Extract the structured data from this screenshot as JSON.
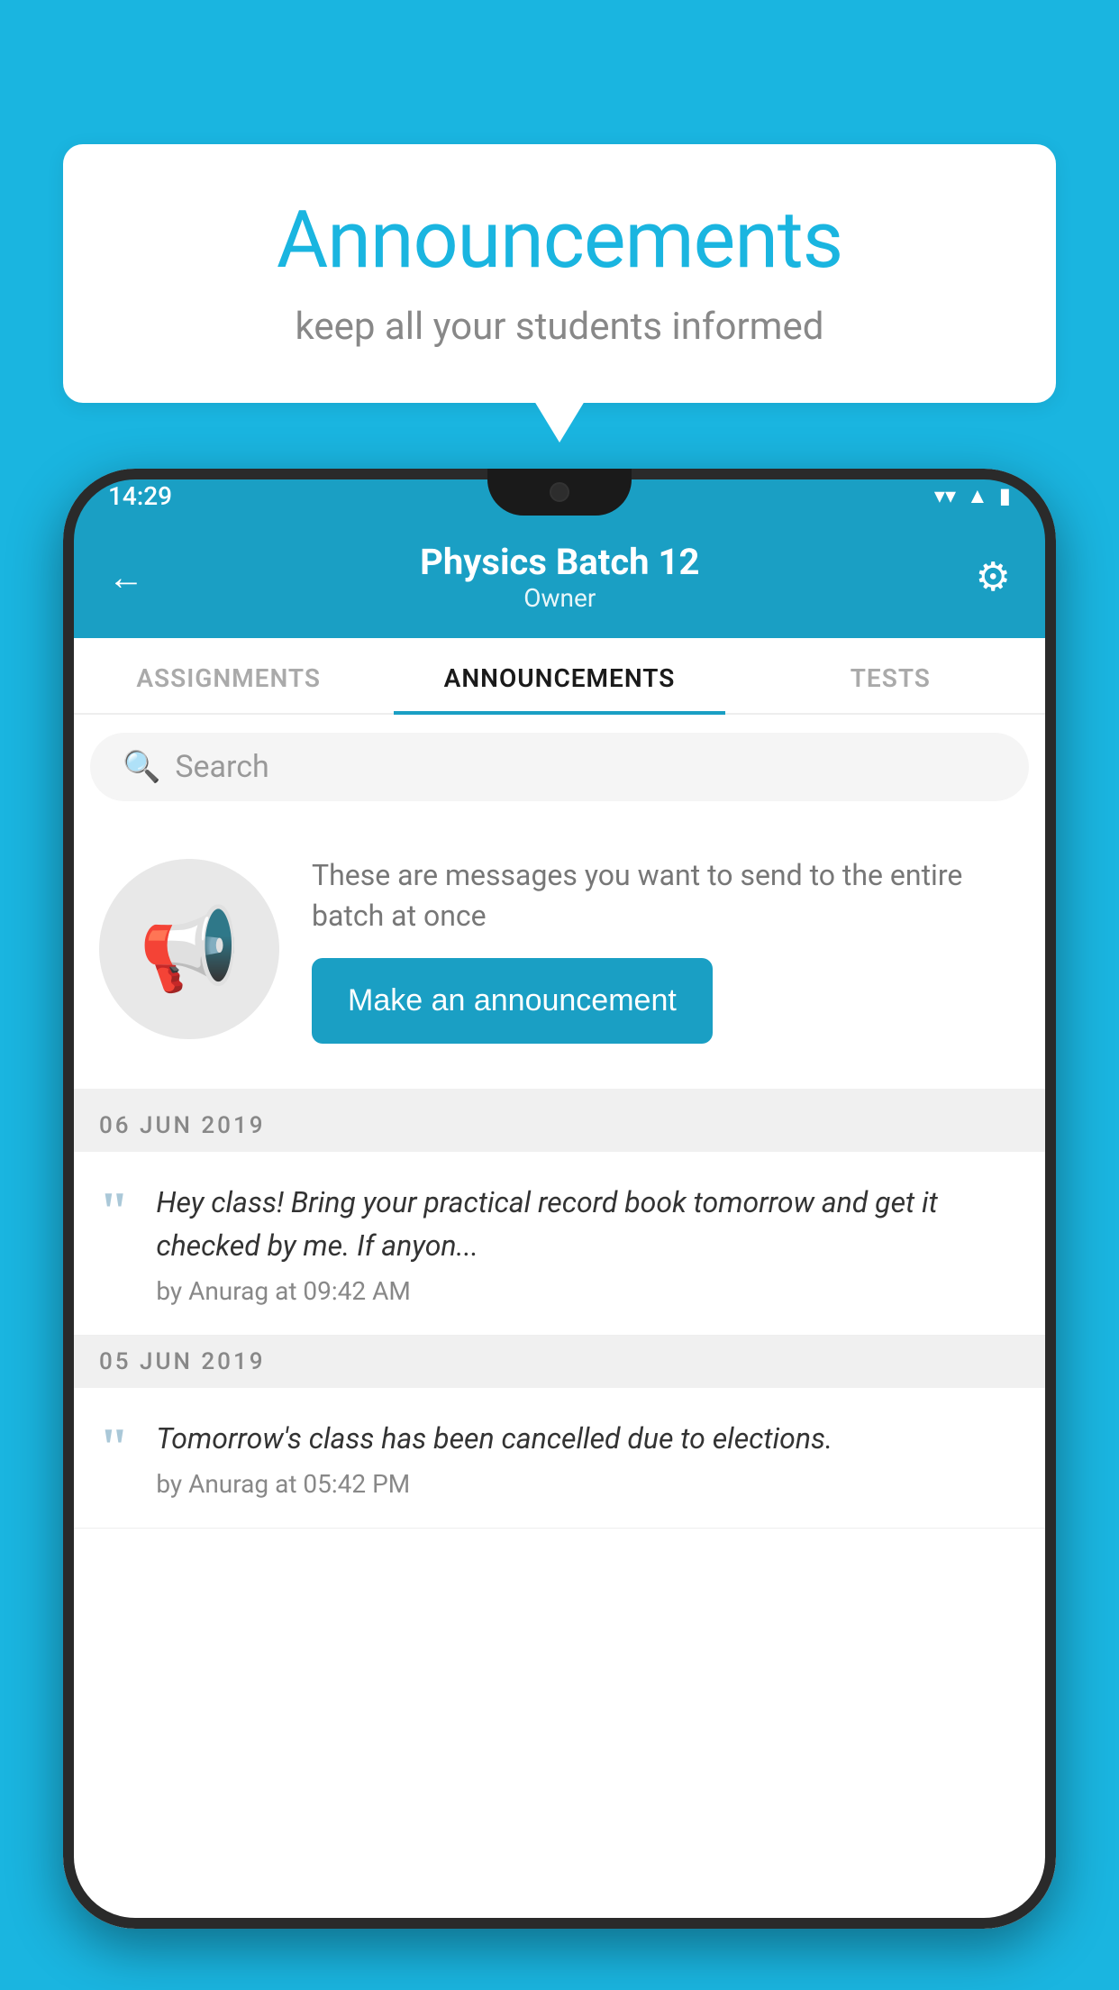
{
  "background_color": "#1ab5e0",
  "speech_bubble": {
    "title": "Announcements",
    "subtitle": "keep all your students informed"
  },
  "phone": {
    "status_bar": {
      "time": "14:29",
      "icons": [
        "wifi",
        "signal",
        "battery"
      ]
    },
    "header": {
      "title": "Physics Batch 12",
      "subtitle": "Owner",
      "back_label": "←",
      "gear_label": "⚙"
    },
    "tabs": [
      {
        "label": "ASSIGNMENTS",
        "active": false
      },
      {
        "label": "ANNOUNCEMENTS",
        "active": true
      },
      {
        "label": "TESTS",
        "active": false
      }
    ],
    "search": {
      "placeholder": "Search"
    },
    "announcement_intro": {
      "description": "These are messages you want to send to the entire batch at once",
      "button_label": "Make an announcement"
    },
    "announcements": [
      {
        "date": "06  JUN  2019",
        "text": "Hey class! Bring your practical record book tomorrow and get it checked by me. If anyon...",
        "meta": "by Anurag at 09:42 AM"
      },
      {
        "date": "05  JUN  2019",
        "text": "Tomorrow's class has been cancelled due to elections.",
        "meta": "by Anurag at 05:42 PM"
      }
    ]
  }
}
